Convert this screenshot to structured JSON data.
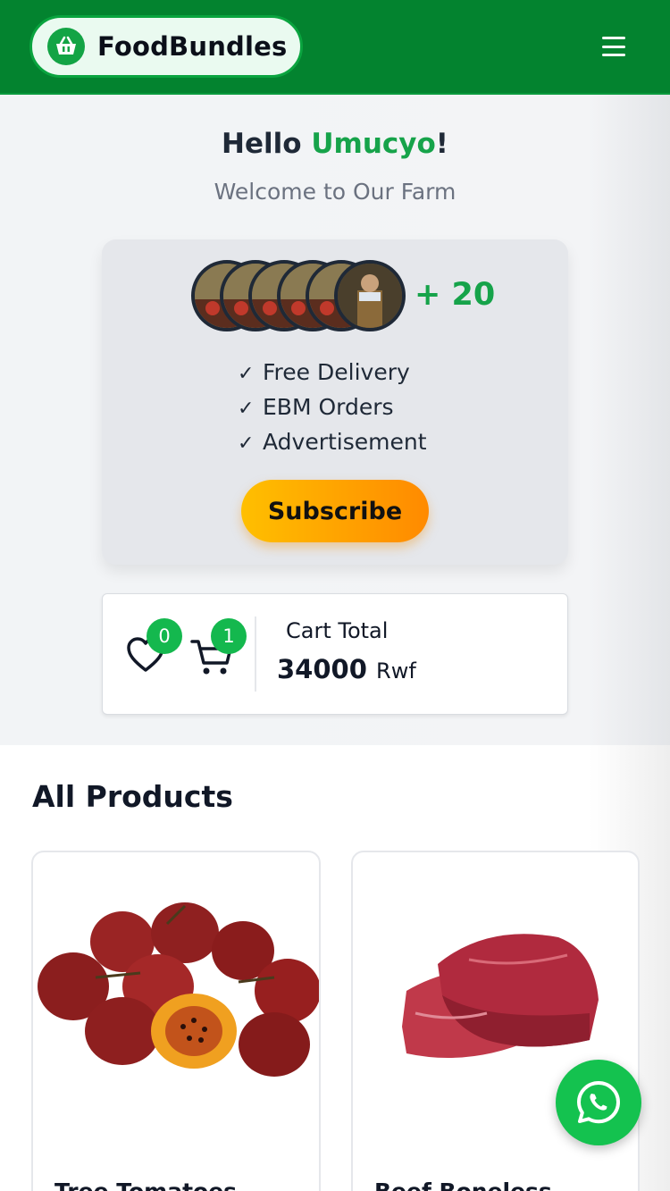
{
  "header": {
    "brand_name": "FoodBundles",
    "logo_icon": "basket-icon",
    "menu_icon": "hamburger-menu-icon",
    "brand_color": "#03832f"
  },
  "hero": {
    "greeting_prefix": "Hello ",
    "user_name": "Umucyo",
    "greeting_suffix": "!",
    "welcome": "Welcome to Our Farm"
  },
  "subscription": {
    "subscriber_count": "+ 20",
    "features": [
      "Free Delivery",
      "EBM Orders",
      "Advertisement"
    ],
    "check_mark": "✓",
    "subscribe_label": "Subscribe",
    "accent_color": "#ffbf00"
  },
  "cart": {
    "favorites_count": "0",
    "cart_count": "1",
    "label": "Cart Total",
    "amount": "34000",
    "currency": "Rwf"
  },
  "products": {
    "title": "All Products",
    "items": [
      {
        "name": "Tree Tomatoes",
        "image": "tree-tomatoes-image"
      },
      {
        "name": "Beef Boneless",
        "image": "beef-image"
      }
    ]
  },
  "whatsapp": {
    "icon": "whatsapp-icon",
    "color": "#14c24f"
  }
}
